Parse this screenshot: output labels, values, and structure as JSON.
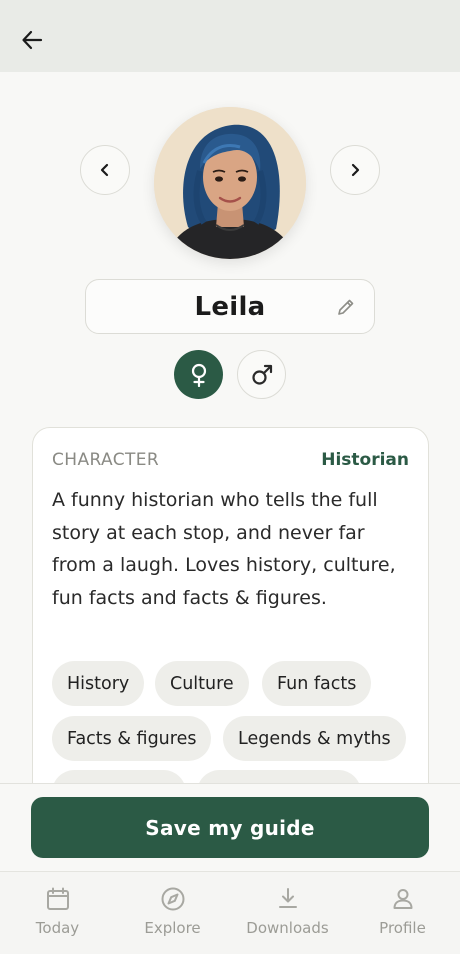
{
  "header": {
    "back_icon": "arrow-left-icon"
  },
  "guide": {
    "name": "Leila",
    "prev_icon": "chevron-left-icon",
    "next_icon": "chevron-right-icon",
    "edit_icon": "pencil-icon",
    "selected_gender": "female"
  },
  "character": {
    "label": "CHARACTER",
    "value": "Historian",
    "description": "A funny historian who tells the full story at each stop, and never far from a laugh. Loves history, culture, fun facts and facts & figures.",
    "tags": [
      "History",
      "Culture",
      "Fun facts",
      "Facts & figures",
      "Legends & myths"
    ]
  },
  "actions": {
    "save_label": "Save my guide"
  },
  "bottom_nav": {
    "items": [
      {
        "label": "Today",
        "icon": "calendar-icon"
      },
      {
        "label": "Explore",
        "icon": "compass-icon"
      },
      {
        "label": "Downloads",
        "icon": "download-icon"
      },
      {
        "label": "Profile",
        "icon": "person-icon"
      }
    ]
  },
  "colors": {
    "accent": "#2b5a45",
    "header_bg": "#e9ebe7",
    "chip_bg": "#eeeeea",
    "nav_text": "#9c9c96"
  }
}
